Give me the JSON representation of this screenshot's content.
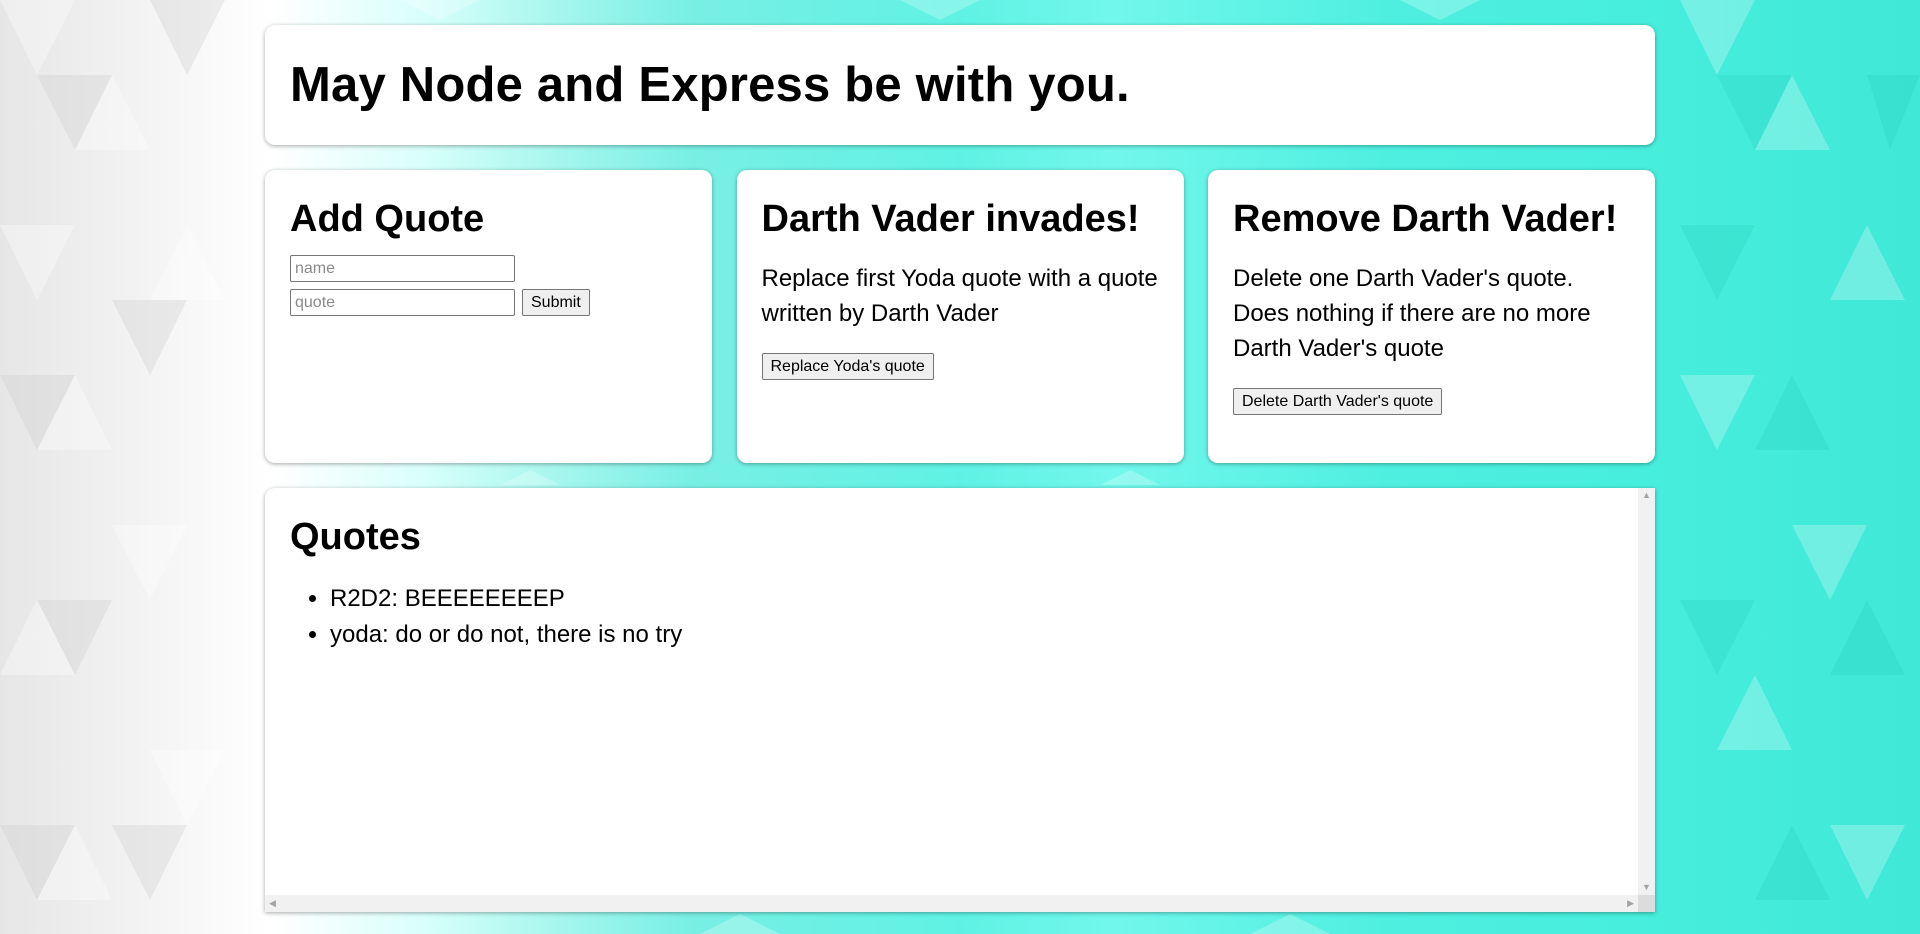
{
  "header": {
    "title": "May Node and Express be with you."
  },
  "add_quote": {
    "title": "Add Quote",
    "name_placeholder": "name",
    "quote_placeholder": "quote",
    "submit_label": "Submit"
  },
  "vader_invades": {
    "title": "Darth Vader invades!",
    "description": "Replace first Yoda quote with a quote written by Darth Vader",
    "button_label": "Replace Yoda's quote"
  },
  "remove_vader": {
    "title": "Remove Darth Vader!",
    "description": "Delete one Darth Vader's quote. Does nothing if there are no more Darth Vader's quote",
    "button_label": "Delete Darth Vader's quote"
  },
  "quotes": {
    "title": "Quotes",
    "items": [
      "R2D2: BEEEEEEEEP",
      "yoda: do or do not, there is no try"
    ]
  }
}
